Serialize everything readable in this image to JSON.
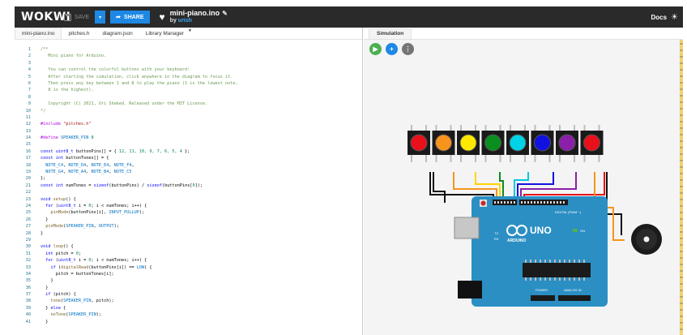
{
  "topbar": {
    "logo": "WOKWI",
    "save_label": "SAVE",
    "dropdown_glyph": "▾",
    "share_label": "SHARE",
    "project_name": "mini-piano.ino",
    "by_label": "by",
    "author": "urish",
    "docs_label": "Docs"
  },
  "editor": {
    "tabs": [
      "mini-piano.ino",
      "pitches.h",
      "diagram.json",
      "Library Manager"
    ],
    "active_tab": 0,
    "line_numbers": [
      "1",
      "2",
      "3",
      "4",
      "5",
      "6",
      "7",
      "8",
      "9",
      "10",
      "11",
      "12",
      "13",
      "14",
      "15",
      "16",
      "17",
      "18",
      "19",
      "20",
      "21",
      "22",
      "23",
      "24",
      "25",
      "26",
      "27",
      "28",
      "29",
      "30",
      "31",
      "32",
      "33",
      "34",
      "35",
      "36",
      "37",
      "38",
      "39",
      "40",
      "41"
    ]
  },
  "simulation": {
    "tab_label": "Simulation",
    "controls": [
      "play-icon",
      "add-icon",
      "more-icon"
    ],
    "board_label": "UNO",
    "board_sub": "ARDUINO",
    "digital_label": "DIGITAL (PWM ~)",
    "power_label": "POWER",
    "analog_label": "ANALOG IN",
    "tx_label": "TX",
    "rx_label": "RX",
    "on_label": "ON",
    "button_colors": [
      "#e8101a",
      "#f7941d",
      "#ffe800",
      "#0a8e1e",
      "#00d2e8",
      "#1212e0",
      "#8a1fa8",
      "#e8101a"
    ]
  },
  "colors": {
    "accent": "#1e88e5",
    "play": "#4caf50",
    "board": "#2b8fc4"
  }
}
